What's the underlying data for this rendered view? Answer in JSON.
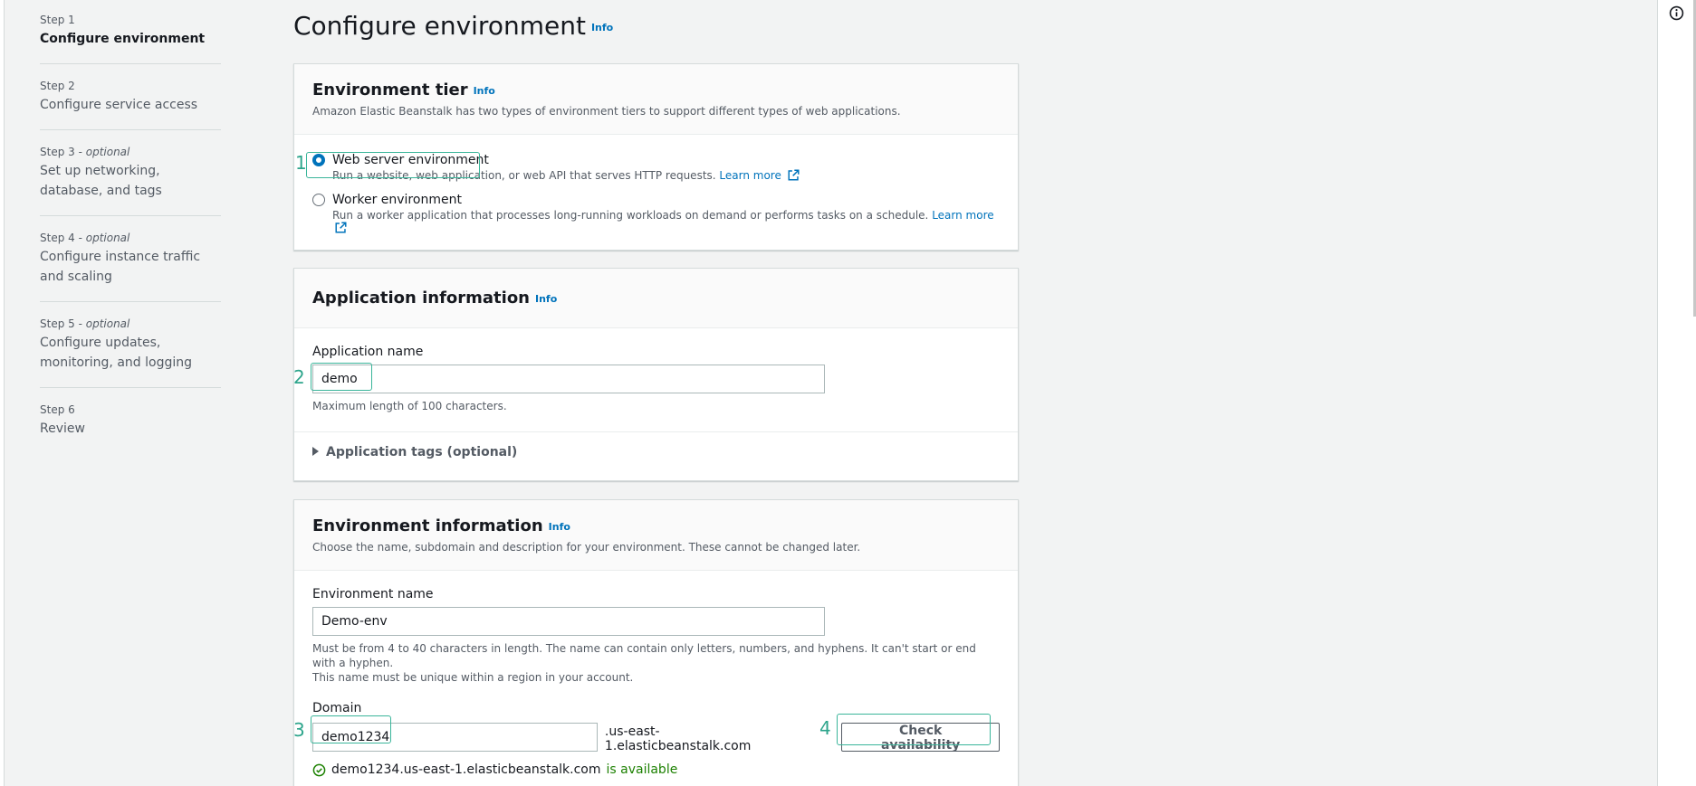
{
  "steps": [
    {
      "num": "Step 1",
      "optional": "",
      "label": "Configure environment"
    },
    {
      "num": "Step 2",
      "optional": "",
      "label": "Configure service access"
    },
    {
      "num": "Step 3 - ",
      "optional": "optional",
      "label": "Set up networking, database, and tags"
    },
    {
      "num": "Step 4 - ",
      "optional": "optional",
      "label": "Configure instance traffic and scaling"
    },
    {
      "num": "Step 5 - ",
      "optional": "optional",
      "label": "Configure updates, monitoring, and logging"
    },
    {
      "num": "Step 6",
      "optional": "",
      "label": "Review"
    }
  ],
  "page": {
    "title": "Configure environment",
    "info": "Info"
  },
  "tier": {
    "title": "Environment tier",
    "info": "Info",
    "desc": "Amazon Elastic Beanstalk has two types of environment tiers to support different types of web applications.",
    "options": [
      {
        "label": "Web server environment",
        "desc": "Run a website, web application, or web API that serves HTTP requests.",
        "learn": "Learn more",
        "checked": true
      },
      {
        "label": "Worker environment",
        "desc": "Run a worker application that processes long-running workloads on demand or performs tasks on a schedule.",
        "learn": "Learn more",
        "checked": false
      }
    ]
  },
  "app": {
    "title": "Application information",
    "info": "Info",
    "name_label": "Application name",
    "name_value": "demo",
    "name_hint": "Maximum length of 100 characters.",
    "tags_label": "Application tags (optional)"
  },
  "env": {
    "title": "Environment information",
    "info": "Info",
    "desc": "Choose the name, subdomain and description for your environment. These cannot be changed later.",
    "name_label": "Environment name",
    "name_value": "Demo-env",
    "name_hint_1": "Must be from 4 to 40 characters in length. The name can contain only letters, numbers, and hyphens. It can't start or end with a hyphen.",
    "name_hint_2": "This name must be unique within a region in your account.",
    "domain_label": "Domain",
    "domain_value": "demo1234",
    "domain_suffix": ".us-east-1.elasticbeanstalk.com",
    "check_button": "Check availability",
    "avail_host": "demo1234.us-east-1.elasticbeanstalk.com",
    "avail_status": "is available"
  },
  "annotations": [
    "1",
    "2",
    "3",
    "4"
  ],
  "colors": {
    "accent": "#0073bb",
    "success": "#1d8102",
    "annotation": "#3ab59a"
  },
  "icons": {
    "external": "external-link-icon",
    "check": "check-circle-icon",
    "info": "info-circle-icon"
  }
}
